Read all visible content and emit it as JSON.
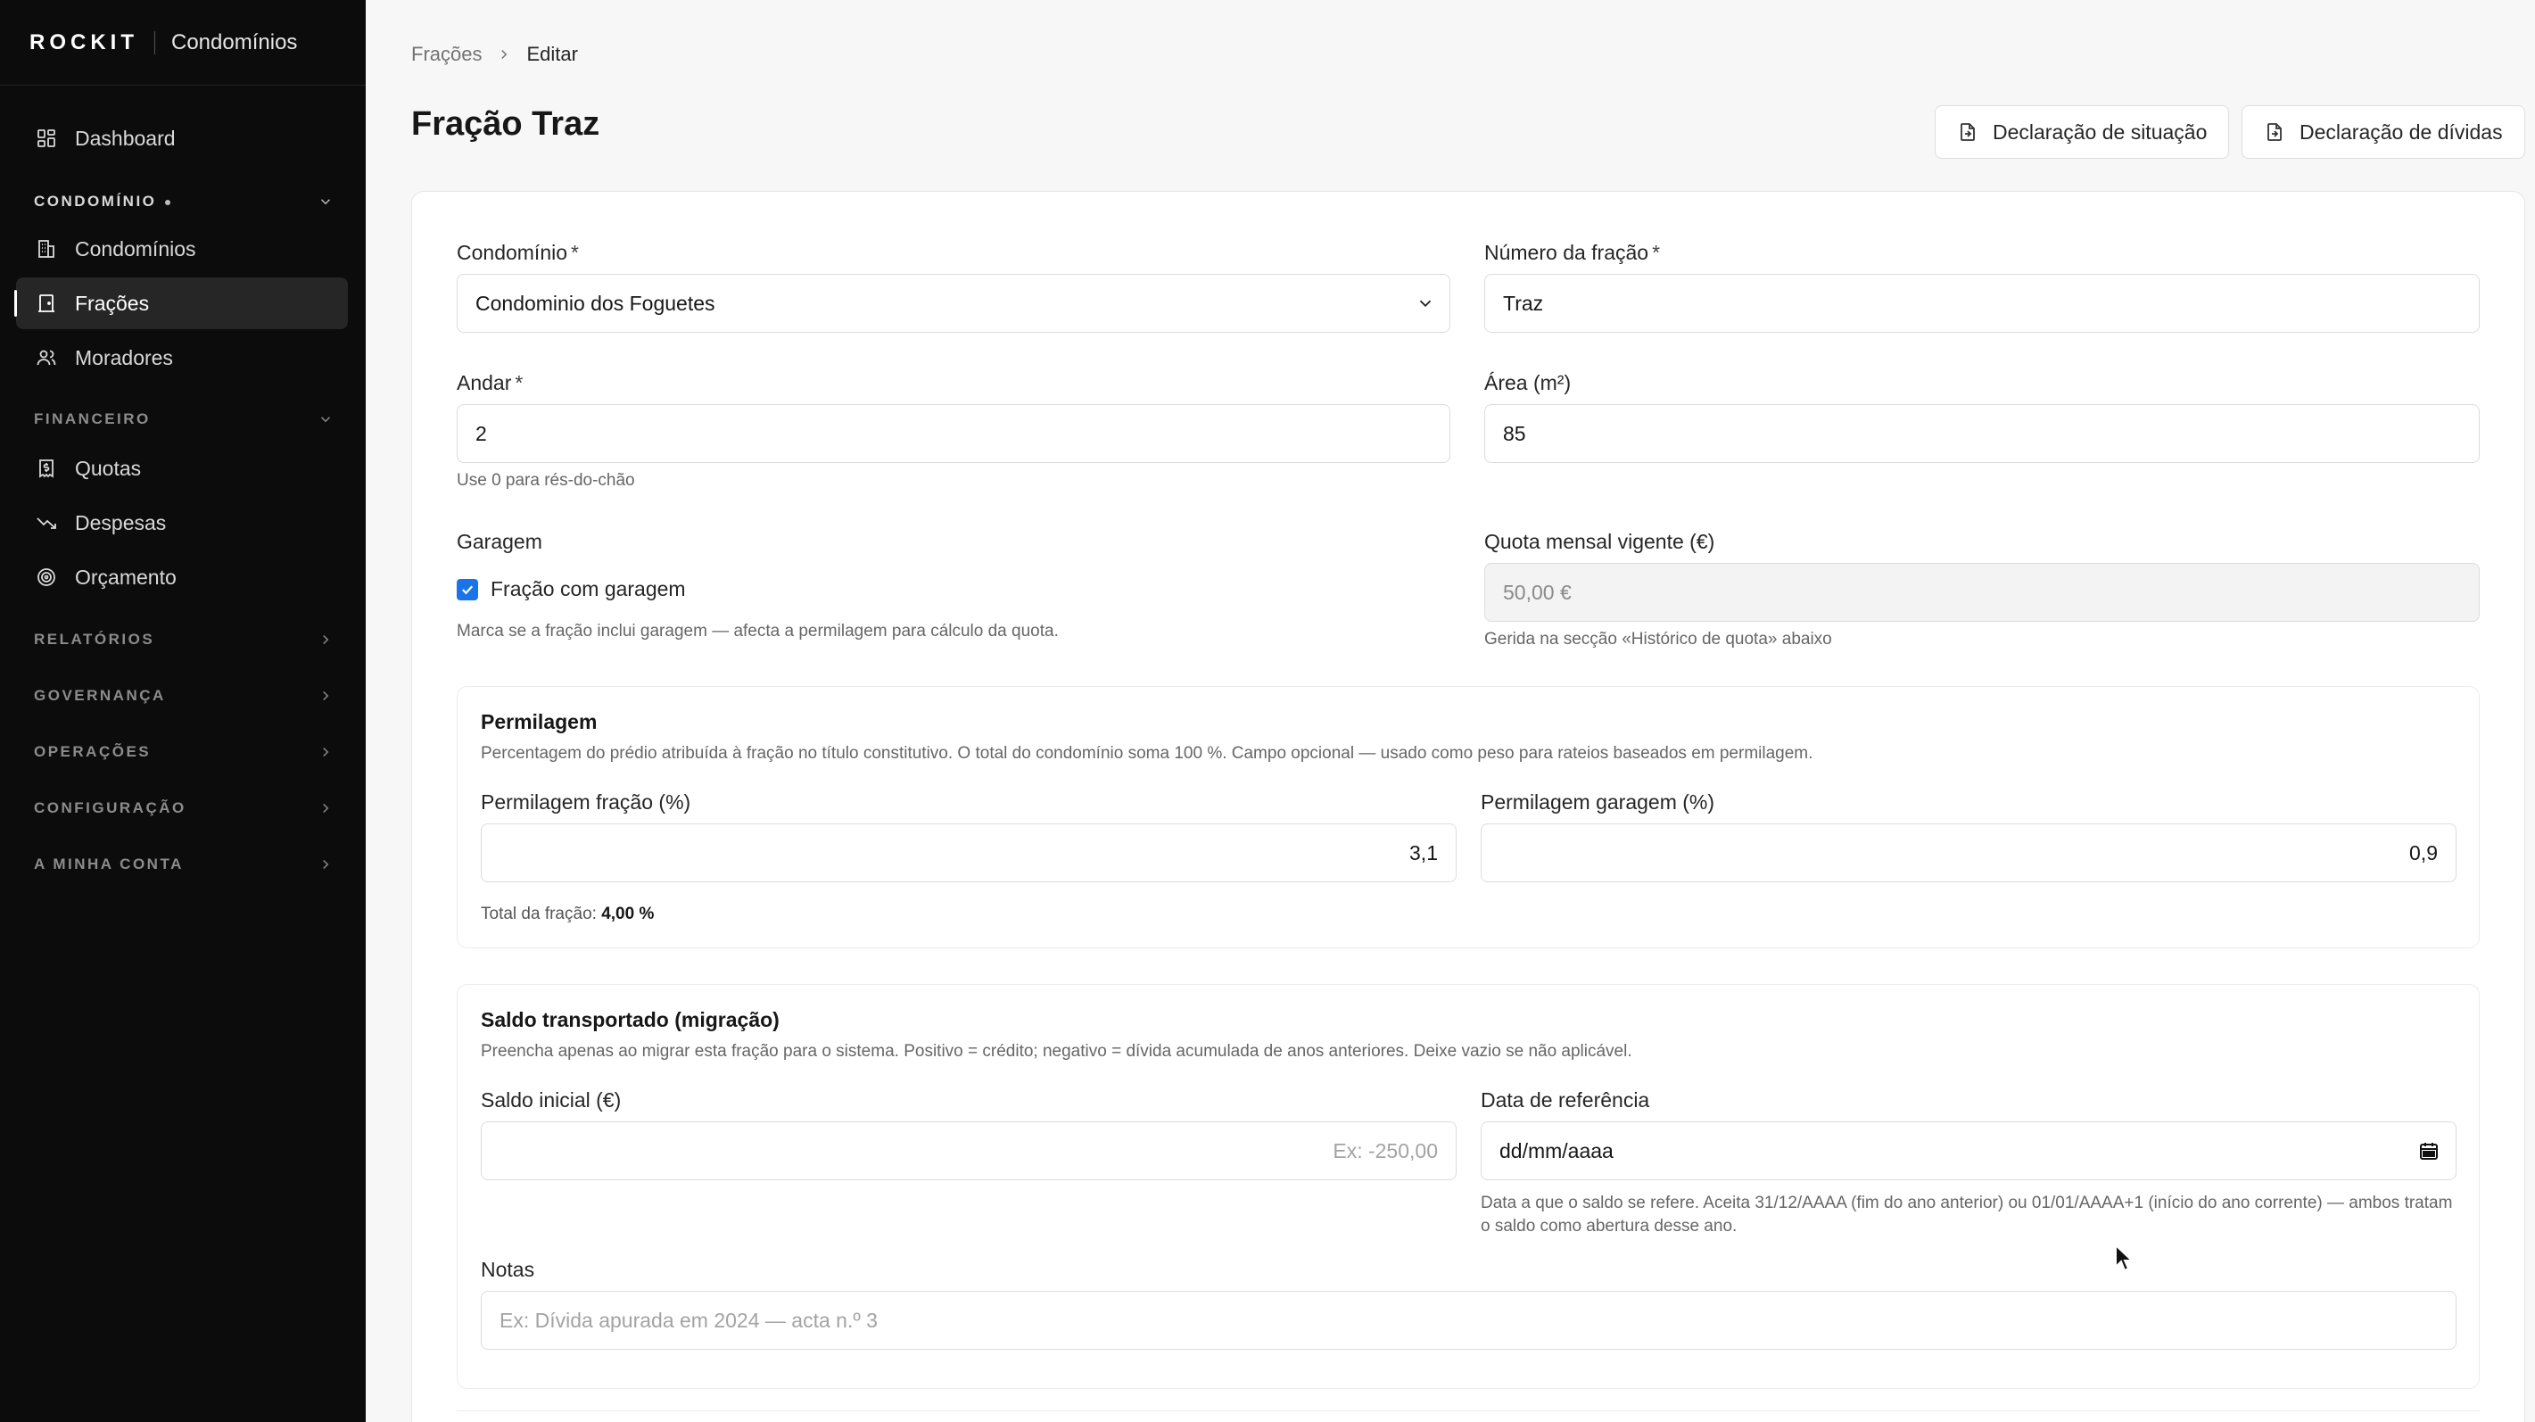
{
  "brand": {
    "logo": "ROCKIT",
    "app": "Condomínios"
  },
  "sidebar": {
    "dashboard": "Dashboard",
    "sections": {
      "condominio": "CONDOMÍNIO",
      "financeiro": "FINANCEIRO",
      "relatorios": "RELATÓRIOS",
      "governanca": "GOVERNANÇA",
      "operacoes": "OPERAÇÕES",
      "configuracao": "CONFIGURAÇÃO",
      "conta": "A MINHA CONTA"
    },
    "items": {
      "condominios": "Condomínios",
      "fracoes": "Frações",
      "moradores": "Moradores",
      "quotas": "Quotas",
      "despesas": "Despesas",
      "orcamento": "Orçamento"
    }
  },
  "breadcrumb": {
    "parent": "Frações",
    "current": "Editar"
  },
  "page": {
    "title": "Fração Traz"
  },
  "actions": {
    "situacao": "Declaração de situação",
    "dividas": "Declaração de dívidas"
  },
  "form": {
    "condominio": {
      "label": "Condomínio",
      "value": "Condominio dos Foguetes"
    },
    "numero": {
      "label": "Número da fração",
      "value": "Traz"
    },
    "andar": {
      "label": "Andar",
      "value": "2",
      "hint": "Use 0 para rés-do-chão"
    },
    "area": {
      "label": "Área (m²)",
      "value": "85"
    },
    "garagem": {
      "label": "Garagem",
      "checkbox": "Fração com garagem",
      "checked": true,
      "hint": "Marca se a fração inclui garagem — afecta a permilagem para cálculo da quota."
    },
    "quota": {
      "label": "Quota mensal vigente (€)",
      "value": "50,00 €",
      "hint": "Gerida na secção «Histórico de quota» abaixo"
    },
    "required_mark": "*"
  },
  "permilagem": {
    "title": "Permilagem",
    "desc": "Percentagem do prédio atribuída à fração no título constitutivo. O total do condomínio soma 100 %. Campo opcional — usado como peso para rateios baseados em permilagem.",
    "fracao_label": "Permilagem fração (%)",
    "fracao_value": "3,1",
    "garagem_label": "Permilagem garagem (%)",
    "garagem_value": "0,9",
    "total_label": "Total da fração:",
    "total_value": "4,00 %"
  },
  "saldo": {
    "title": "Saldo transportado (migração)",
    "desc": "Preencha apenas ao migrar esta fração para o sistema. Positivo = crédito; negativo = dívida acumulada de anos anteriores. Deixe vazio se não aplicável.",
    "inicial_label": "Saldo inicial (€)",
    "inicial_placeholder": "Ex: -250,00",
    "data_label": "Data de referência",
    "data_placeholder": "dd/mm/aaaa",
    "data_hint": "Data a que o saldo se refere. Aceita 31/12/AAAA (fim do ano anterior) ou 01/01/AAAA+1 (início do ano corrente) — ambos tratam o saldo como abertura desse ano.",
    "notas_label": "Notas",
    "notas_placeholder": "Ex: Dívida apurada em 2024 — acta n.º 3"
  },
  "colors": {
    "sidebar_bg": "#0c0c0c",
    "checkbox": "#1a73e8",
    "page_bg": "#f7f7f7"
  }
}
